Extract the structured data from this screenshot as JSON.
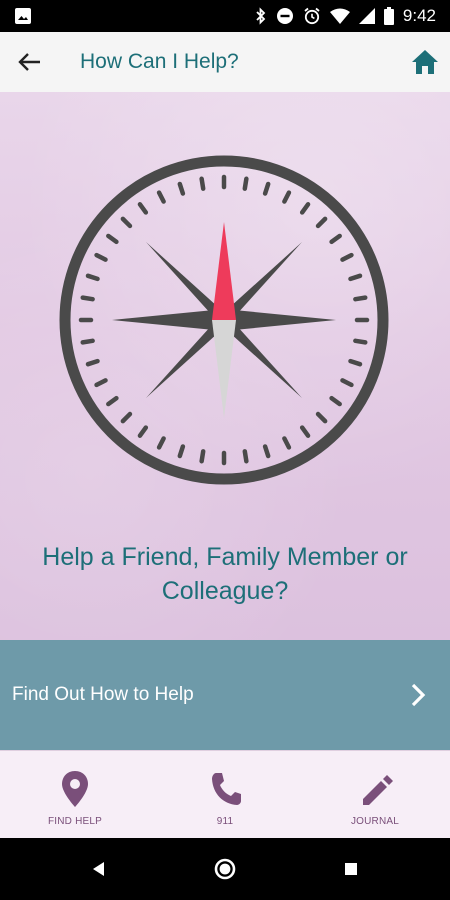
{
  "status_bar": {
    "time": "9:42",
    "icons": [
      "image-icon",
      "bluetooth-icon",
      "do-not-disturb-icon",
      "alarm-icon",
      "wifi-icon",
      "signal-icon",
      "battery-icon"
    ]
  },
  "app_bar": {
    "title": "How Can I Help?",
    "back_icon": "arrow-left-icon",
    "home_icon": "home-icon"
  },
  "main": {
    "illustration": "compass-icon",
    "prompt": "Help a Friend, Family Member or Colleague?"
  },
  "cta": {
    "label": "Find Out How to Help",
    "icon": "chevron-right-icon"
  },
  "bottom_nav": {
    "items": [
      {
        "label": "FIND HELP",
        "icon": "map-pin-icon"
      },
      {
        "label": "911",
        "icon": "phone-icon"
      },
      {
        "label": "JOURNAL",
        "icon": "pencil-icon"
      }
    ]
  },
  "colors": {
    "accent_teal": "#1d6f78",
    "cta_background": "#6e9aa9",
    "nav_icon": "#7a4f7a",
    "compass_red": "#ee3b5b",
    "compass_dark": "#4a4a4a"
  }
}
